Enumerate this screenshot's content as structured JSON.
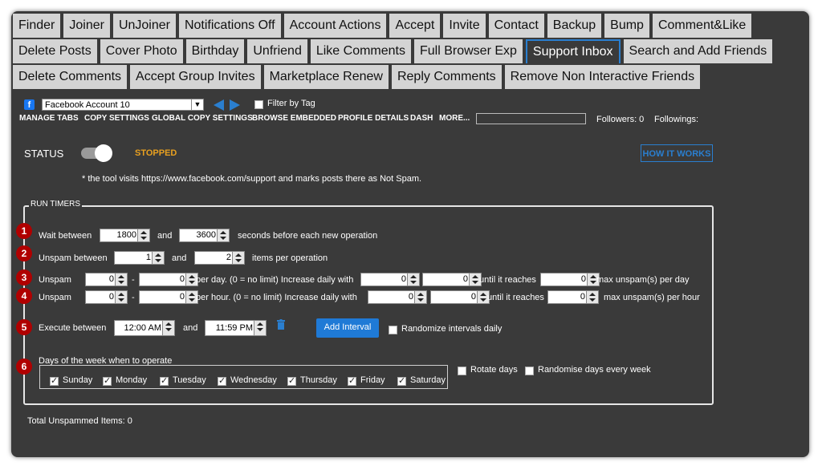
{
  "tabs": {
    "row1": [
      "Finder",
      "Joiner",
      "UnJoiner",
      "Notifications Off",
      "Account Actions",
      "Accept",
      "Invite",
      "Contact",
      "Backup",
      "Bump",
      "Comment&Like"
    ],
    "row2": [
      "Delete Posts",
      "Cover Photo",
      "Birthday",
      "Unfriend",
      "Like Comments",
      "Full Browser Exp",
      "Support Inbox",
      "Search and Add Friends"
    ],
    "row3": [
      "Delete Comments",
      "Accept Group Invites",
      "Marketplace Renew",
      "Reply Comments",
      "Remove Non Interactive Friends"
    ],
    "active": "Support Inbox"
  },
  "account": {
    "selected": "Facebook Account 10",
    "filter_label": "Filter by Tag"
  },
  "menu": [
    "MANAGE TABS",
    "COPY SETTINGS",
    "GLOBAL COPY SETTINGS",
    "BROWSE EMBEDDED",
    "PROFILE DETAILS",
    "DASH",
    "MORE..."
  ],
  "followers_label": "Followers: 0",
  "followings_label": "Followings:",
  "status": {
    "label": "STATUS",
    "state": "STOPPED",
    "state_color": "#e8a020"
  },
  "how_it_works": "HOW IT WORKS",
  "note": "* the tool visits https://www.facebook.com/support and marks posts there as Not Spam.",
  "run_timers": {
    "legend": "RUN TIMERS",
    "wait": {
      "label": "Wait between",
      "min": "1800",
      "and": "and",
      "max": "3600",
      "suffix": "seconds before each new operation"
    },
    "unspam": {
      "label": "Unspam between",
      "min": "1",
      "and": "and",
      "max": "2",
      "suffix": "items per operation"
    },
    "per_day": {
      "label": "Unspam",
      "a": "0",
      "dash": "-",
      "b": "0",
      "mid": "per day. (0 = no limit)  Increase daily with",
      "c": "0",
      "d": "0",
      "reach": "until it reaches",
      "e": "0",
      "suffix": "max unspam(s) per day"
    },
    "per_hour": {
      "label": "Unspam",
      "a": "0",
      "dash": "-",
      "b": "0",
      "mid": "per hour. (0 = no limit)  Increase daily with",
      "c": "0",
      "d": "0",
      "reach": "until it reaches",
      "e": "0",
      "suffix": "max unspam(s) per hour"
    },
    "execute": {
      "label": "Execute between",
      "start": "12:00 AM",
      "and": "and",
      "end": "11:59 PM",
      "add": "Add Interval",
      "randomize": "Randomize intervals daily"
    },
    "days": {
      "label": "Days of the week when to operate",
      "list": [
        "Sunday",
        "Monday",
        "Tuesday",
        "Wednesday",
        "Thursday",
        "Friday",
        "Saturday"
      ],
      "rotate": "Rotate days",
      "randomise": "Randomise days every week"
    },
    "badges": [
      "1",
      "2",
      "3",
      "4",
      "5",
      "6"
    ]
  },
  "total": "Total Unspammed Items: 0"
}
